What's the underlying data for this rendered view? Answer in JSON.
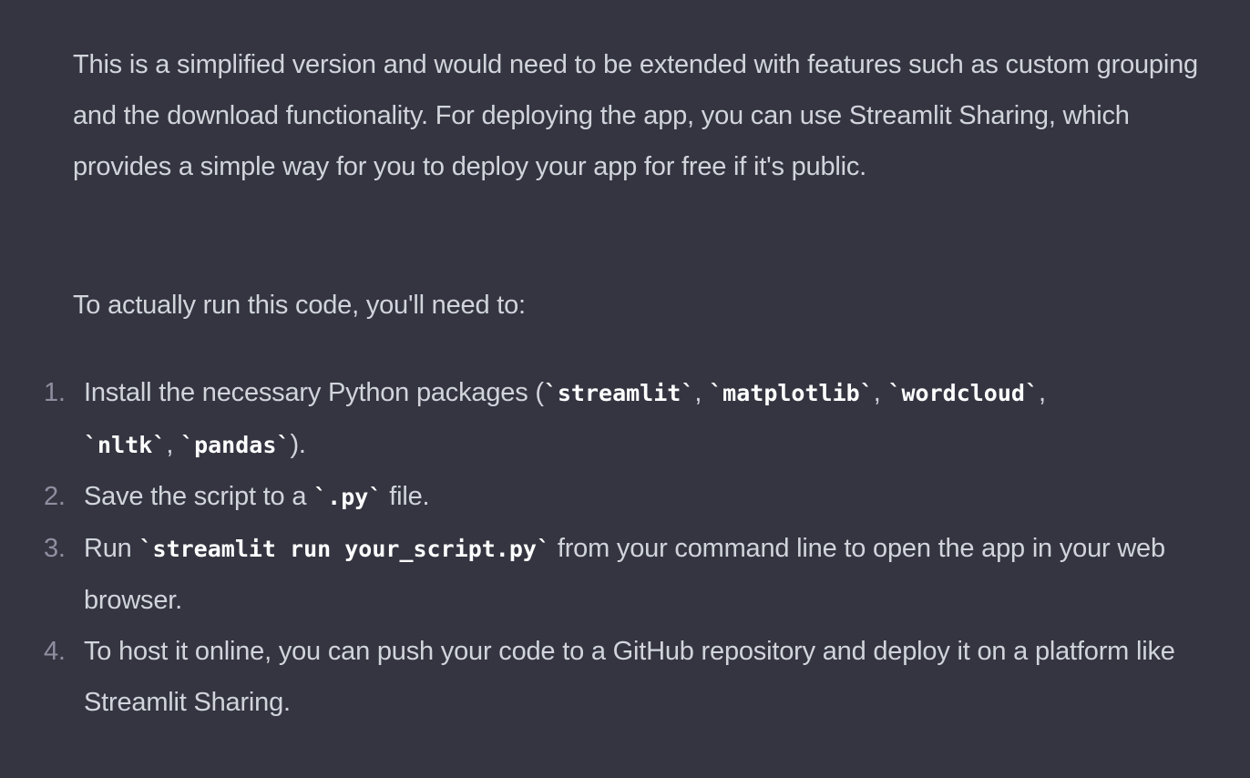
{
  "message": {
    "paragraph_1": "This is a simplified version and would need to be extended with features such as custom grouping and the download functionality. For deploying the app, you can use Streamlit Sharing, which provides a simple way for you to deploy your app for free if it's public.",
    "paragraph_2": "To actually run this code, you'll need to:",
    "steps": [
      {
        "number": "1.",
        "text_before": "Install the necessary Python packages (",
        "code_1": "`streamlit`",
        "sep_1": ", ",
        "code_2": "`matplotlib`",
        "sep_2": ", ",
        "code_3": "`wordcloud`",
        "sep_3": ", ",
        "code_4": "`nltk`",
        "sep_4": ", ",
        "code_5": "`pandas`",
        "text_after": ")."
      },
      {
        "number": "2.",
        "text_before": "Save the script to a ",
        "code": "`.py`",
        "text_after": " file."
      },
      {
        "number": "3.",
        "text_before": "Run ",
        "code": "`streamlit run your_script.py`",
        "text_after": " from your command line to open the app in your web browser."
      },
      {
        "number": "4.",
        "text": "To host it online, you can push your code to a GitHub repository and deploy it on a platform like Streamlit Sharing."
      }
    ]
  },
  "colors": {
    "background": "#343541",
    "text": "#d1d5db",
    "list_number": "#8e8ea0",
    "code": "#ffffff"
  }
}
